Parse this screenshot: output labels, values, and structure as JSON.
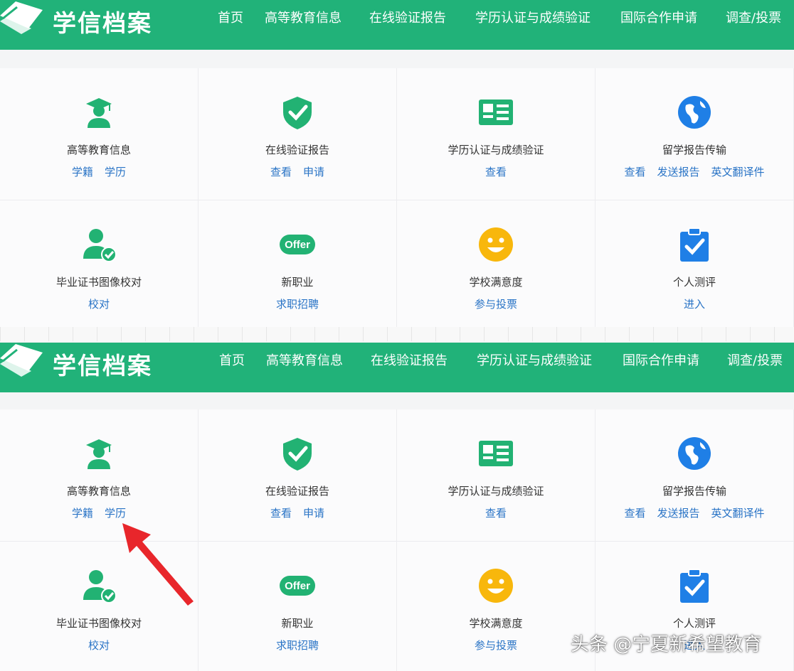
{
  "brand": "学信档案",
  "nav": [
    "首页",
    "高等教育信息",
    "在线验证报告",
    "学历认证与成绩验证",
    "国际合作申请",
    "调查/投票"
  ],
  "cards": [
    {
      "title": "高等教育信息",
      "icon": "graduate-icon",
      "links": [
        "学籍",
        "学历"
      ]
    },
    {
      "title": "在线验证报告",
      "icon": "shield-check-icon",
      "links": [
        "查看",
        "申请"
      ]
    },
    {
      "title": "学历认证与成绩验证",
      "icon": "id-card-icon",
      "links": [
        "查看"
      ]
    },
    {
      "title": "留学报告传输",
      "icon": "globe-icon",
      "links": [
        "查看",
        "发送报告",
        "英文翻译件"
      ]
    },
    {
      "title": "毕业证书图像校对",
      "icon": "user-check-icon",
      "links": [
        "校对"
      ]
    },
    {
      "title": "新职业",
      "icon": "offer-icon",
      "offer_text": "Offer",
      "links": [
        "求职招聘"
      ]
    },
    {
      "title": "学校满意度",
      "icon": "smiley-icon",
      "links": [
        "参与投票"
      ]
    },
    {
      "title": "个人测评",
      "icon": "clipboard-check-icon",
      "links": [
        "进入"
      ]
    }
  ],
  "watermark": "头条 @宁夏新希望教育",
  "colors": {
    "header": "#21b279",
    "link": "#2a74c6",
    "icon_green": "#22b273",
    "icon_blue": "#1f7fe6",
    "icon_yellow": "#f8b70c",
    "arrow": "#e8262b"
  }
}
